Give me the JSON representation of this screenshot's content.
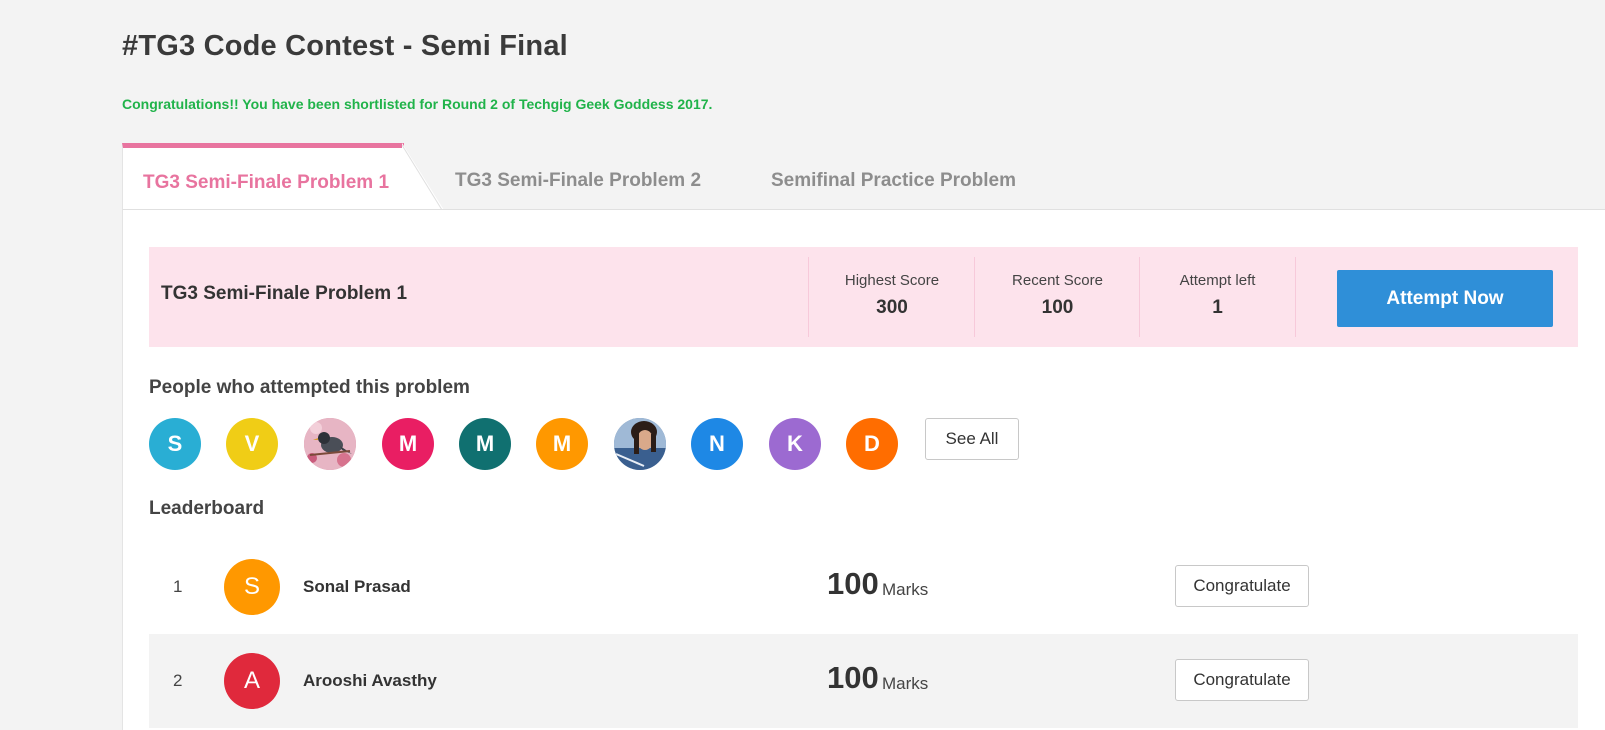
{
  "page": {
    "title": "#TG3 Code Contest - Semi Final",
    "congrats_message": "Congratulations!! You have been shortlisted for Round 2 of Techgig Geek Goddess 2017."
  },
  "tabs": [
    {
      "label": "TG3 Semi-Finale Problem 1",
      "active": true
    },
    {
      "label": "TG3 Semi-Finale Problem 2",
      "active": false
    },
    {
      "label": "Semifinal Practice Problem",
      "active": false
    }
  ],
  "problem": {
    "name": "TG3 Semi-Finale Problem 1",
    "highest_score_label": "Highest Score",
    "highest_score": "300",
    "recent_score_label": "Recent Score",
    "recent_score": "100",
    "attempts_left_label": "Attempt left",
    "attempts_left": "1",
    "attempt_button": "Attempt Now"
  },
  "attempted": {
    "title": "People who attempted this problem",
    "people": [
      {
        "initial": "S",
        "color": "#29aed4",
        "icon": "initial"
      },
      {
        "initial": "V",
        "color": "#f0cd16",
        "icon": "initial"
      },
      {
        "initial": "",
        "color": "#d98aa0",
        "icon": "bird-photo"
      },
      {
        "initial": "M",
        "color": "#e91e63",
        "icon": "initial"
      },
      {
        "initial": "M",
        "color": "#107070",
        "icon": "initial"
      },
      {
        "initial": "M",
        "color": "#ff9800",
        "icon": "initial"
      },
      {
        "initial": "",
        "color": "#5c7fa8",
        "icon": "person-photo"
      },
      {
        "initial": "N",
        "color": "#1e88e5",
        "icon": "initial"
      },
      {
        "initial": "K",
        "color": "#9c6ad1",
        "icon": "initial"
      },
      {
        "initial": "D",
        "color": "#ff6d00",
        "icon": "initial"
      }
    ],
    "see_all": "See All"
  },
  "leaderboard": {
    "title": "Leaderboard",
    "rows": [
      {
        "rank": "1",
        "initial": "S",
        "color": "#ff9800",
        "name": "Sonal Prasad",
        "score": "100",
        "unit": "Marks",
        "button": "Congratulate"
      },
      {
        "rank": "2",
        "initial": "A",
        "color": "#e0293c",
        "name": "Arooshi Avasthy",
        "score": "100",
        "unit": "Marks",
        "button": "Congratulate"
      }
    ]
  },
  "colors": {
    "accent_pink": "#e8749f",
    "success_green": "#20b34a",
    "primary_blue": "#2f8fd8",
    "problem_bar_bg": "#fde3ec"
  }
}
